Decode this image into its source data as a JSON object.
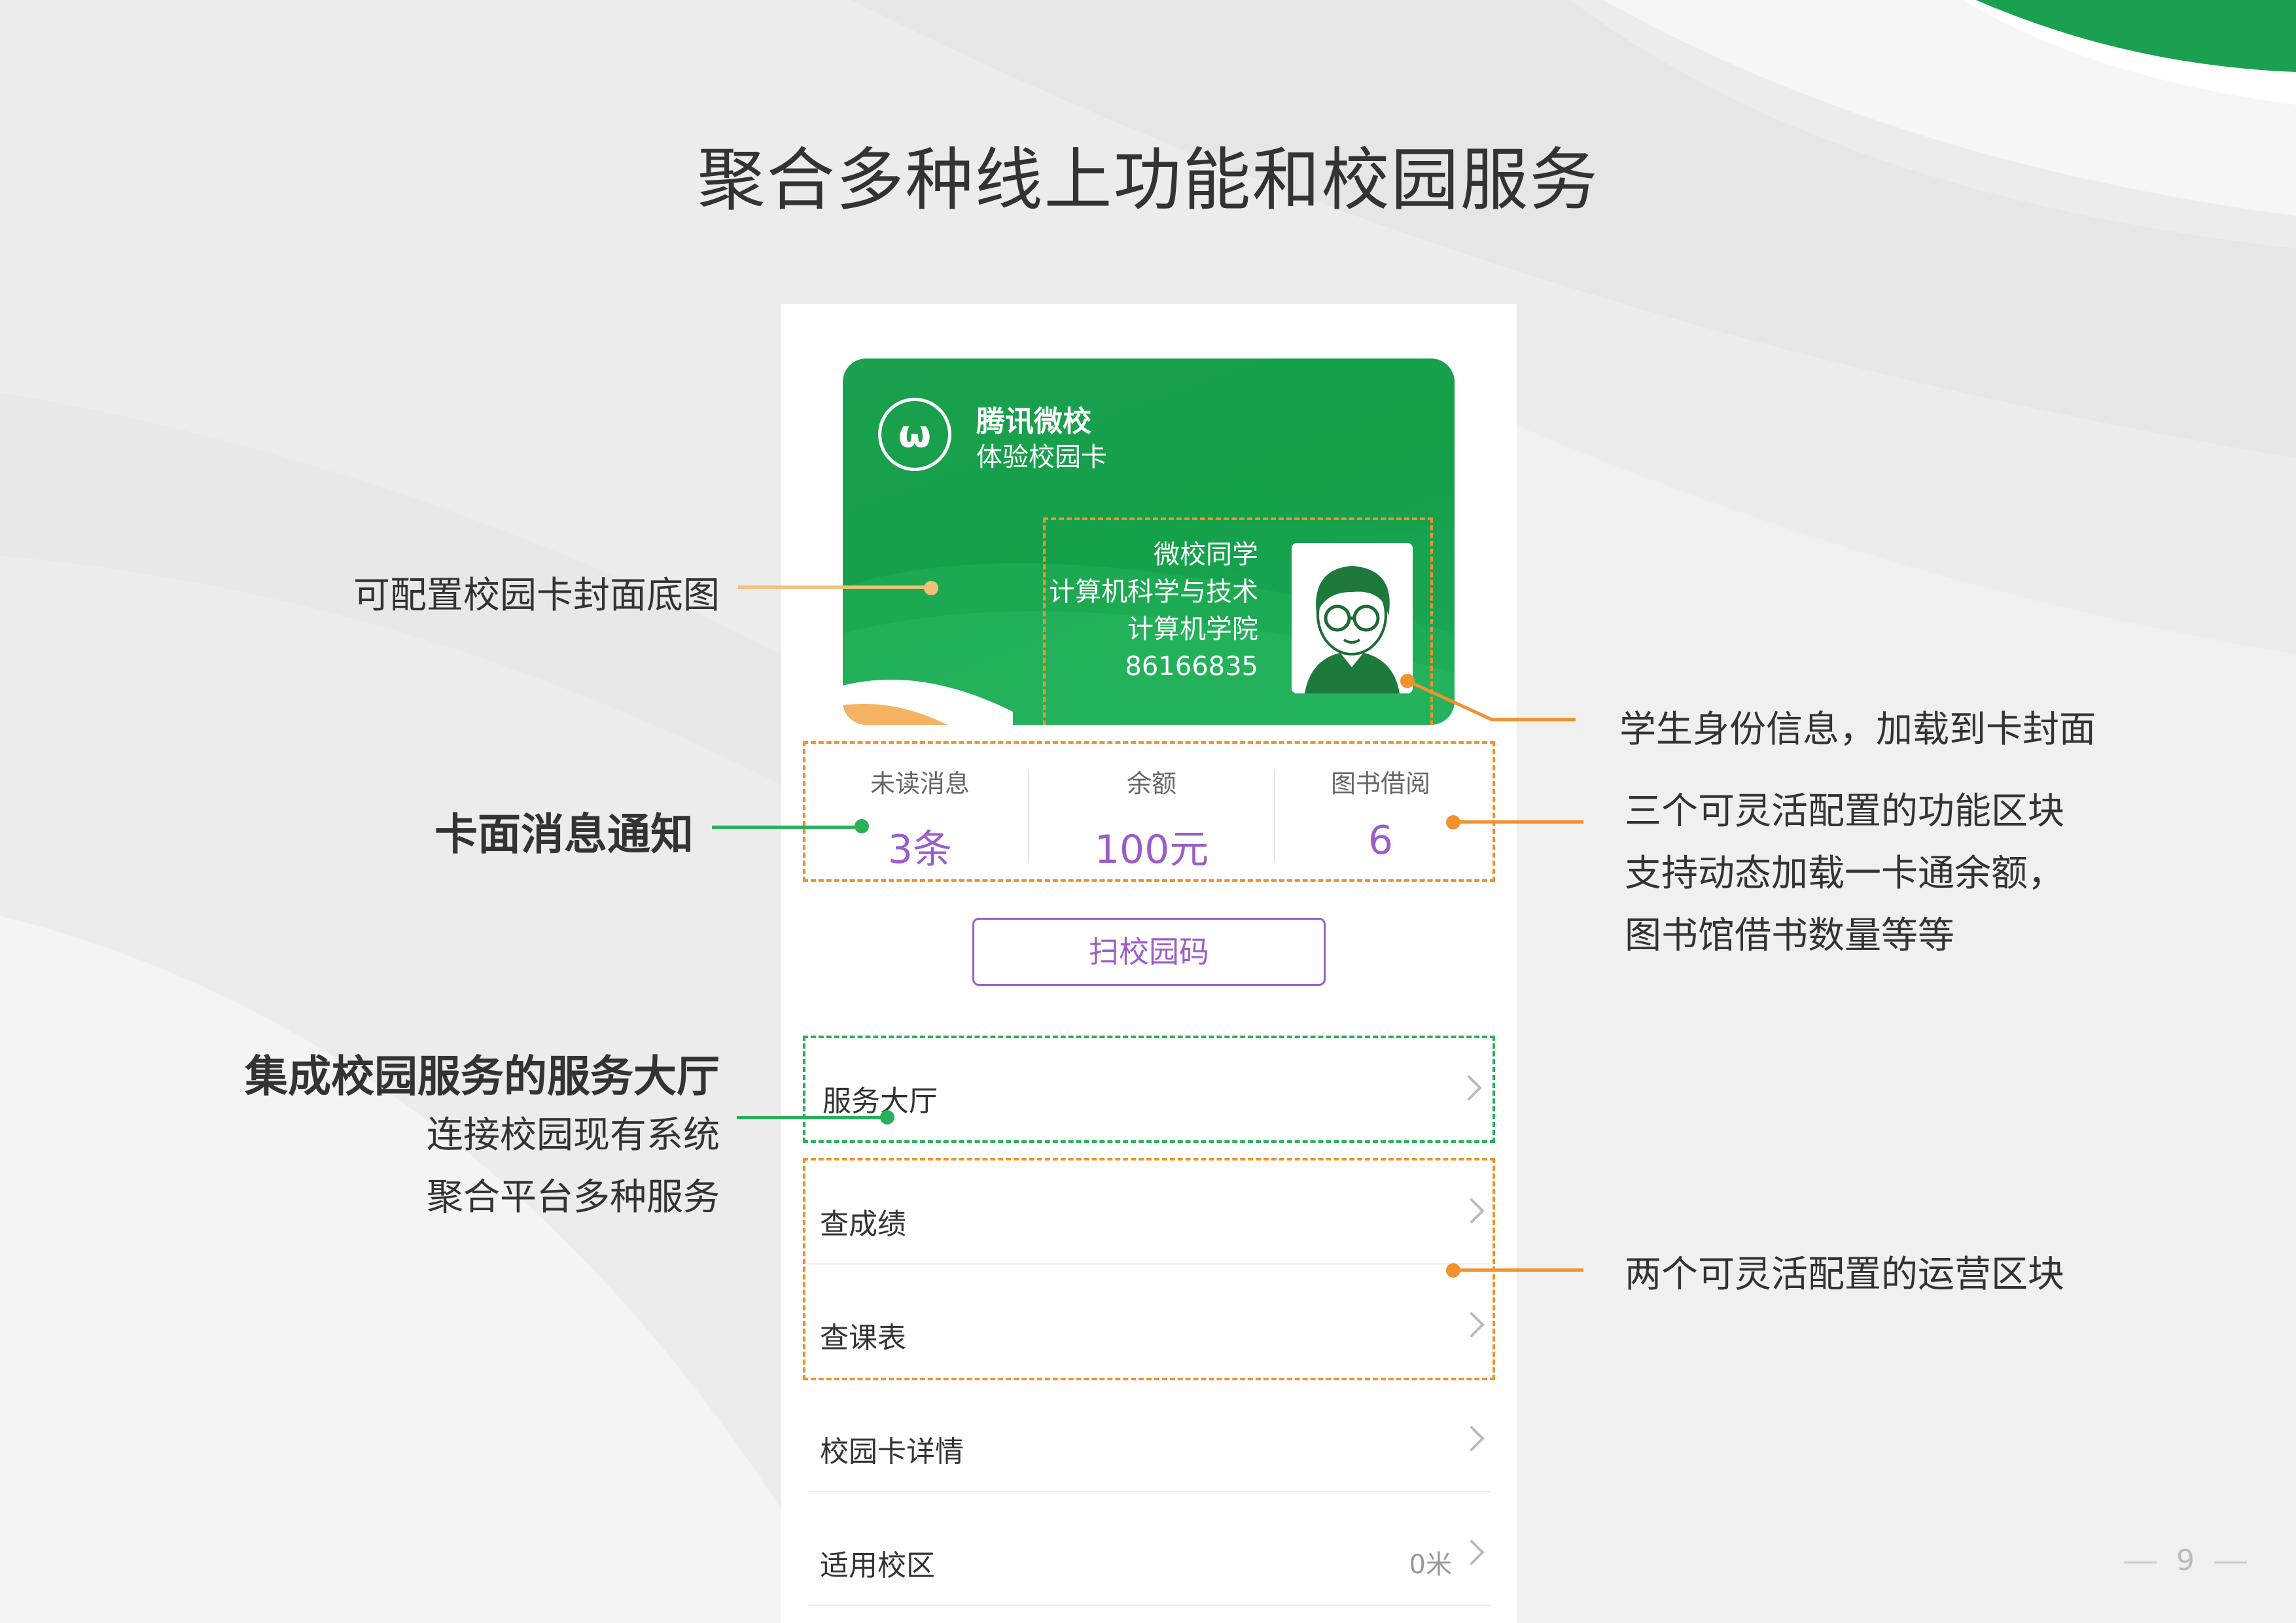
{
  "page": {
    "title": "聚合多种线上功能和校园服务",
    "page_number": "9"
  },
  "card": {
    "brand": "腾讯微校",
    "subtitle": "体验校园卡",
    "logo_text": "ω",
    "name": "微校同学",
    "major": "计算机科学与技术",
    "college": "计算机学院",
    "student_id": "86166835",
    "avatar_icon": "student-avatar-icon"
  },
  "stats": [
    {
      "label": "未读消息",
      "value": "3条"
    },
    {
      "label": "余额",
      "value": "100元"
    },
    {
      "label": "图书借阅",
      "value": "6"
    }
  ],
  "scan_button": "扫校园码",
  "menu": [
    {
      "label": "服务大厅",
      "value": ""
    },
    {
      "label": "查成绩",
      "value": ""
    },
    {
      "label": "查课表",
      "value": ""
    },
    {
      "label": "校园卡详情",
      "value": ""
    },
    {
      "label": "适用校区",
      "value": "0米"
    }
  ],
  "annotations": {
    "cover": "可配置校园卡封面底图",
    "notice": "卡面消息通知",
    "service_hall_title": "集成校园服务的服务大厅",
    "service_hall_line1": "连接校园现有系统",
    "service_hall_line2": "聚合平台多种服务",
    "identity": "学生身份信息，加载到卡封面",
    "blocks_line1": "三个可灵活配置的功能区块",
    "blocks_line2": "支持动态加载一卡通余额，",
    "blocks_line3": "图书馆借书数量等等",
    "ops": "两个可灵活配置的运营区块"
  },
  "colors": {
    "brand_green": "#1aa04e",
    "accent_orange": "#f0922d",
    "light_orange": "#f5c07a",
    "purple": "#9c5dc9",
    "annotation_green": "#29b15a"
  }
}
